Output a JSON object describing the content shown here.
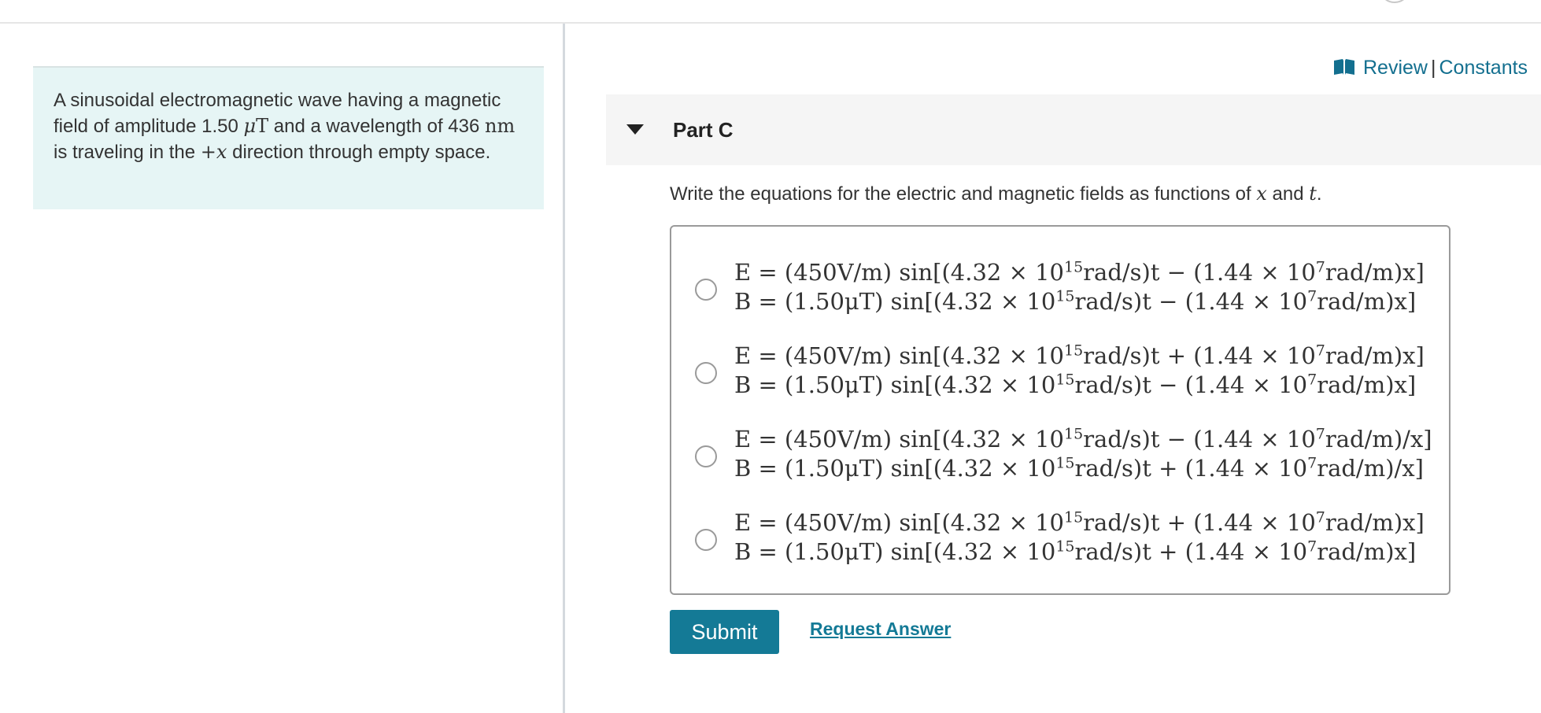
{
  "problem": {
    "seg1": "A sinusoidal electromagnetic wave having a magnetic field of amplitude 1.50 ",
    "mu": "μ",
    "unit_T": "T",
    "seg2": " and a wavelength of 436 ",
    "unit_nm": "nm",
    "seg3": " is traveling in the ",
    "dir": "+x",
    "seg4": " direction through empty space."
  },
  "links": {
    "review": "Review",
    "separator": "|",
    "constants": "Constants"
  },
  "part": {
    "title": "Part C"
  },
  "prompt": {
    "text1": "Write the equations for the electric and magnetic fields as functions of ",
    "var_x": "x",
    "and": " and ",
    "var_t": "t",
    "end": "."
  },
  "choices": [
    {
      "e": {
        "a": "E = (450V/m) sin[(4.32 × 10",
        "exp1": "15",
        "b": "rad/s)t − (1.44 × 10",
        "exp2": "7",
        "c": "rad/m)x]"
      },
      "b": {
        "a": "B = (1.50μT) sin[(4.32 × 10",
        "exp1": "15",
        "b": "rad/s)t − (1.44 × 10",
        "exp2": "7",
        "c": "rad/m)x]"
      }
    },
    {
      "e": {
        "a": "E = (450V/m) sin[(4.32 × 10",
        "exp1": "15",
        "b": "rad/s)t + (1.44 × 10",
        "exp2": "7",
        "c": "rad/m)x]"
      },
      "b": {
        "a": "B = (1.50μT) sin[(4.32 × 10",
        "exp1": "15",
        "b": "rad/s)t − (1.44 × 10",
        "exp2": "7",
        "c": "rad/m)x]"
      }
    },
    {
      "e": {
        "a": "E = (450V/m) sin[(4.32 × 10",
        "exp1": "15",
        "b": "rad/s)t − (1.44 × 10",
        "exp2": "7",
        "c": "rad/m)/x]"
      },
      "b": {
        "a": "B = (1.50μT) sin[(4.32 × 10",
        "exp1": "15",
        "b": "rad/s)t + (1.44 × 10",
        "exp2": "7",
        "c": "rad/m)/x]"
      }
    },
    {
      "e": {
        "a": "E = (450V/m) sin[(4.32 × 10",
        "exp1": "15",
        "b": "rad/s)t + (1.44 × 10",
        "exp2": "7",
        "c": "rad/m)x]"
      },
      "b": {
        "a": "B = (1.50μT) sin[(4.32 × 10",
        "exp1": "15",
        "b": "rad/s)t + (1.44 × 10",
        "exp2": "7",
        "c": "rad/m)x]"
      }
    }
  ],
  "actions": {
    "submit": "Submit",
    "request_answer": "Request Answer"
  },
  "colors": {
    "accent": "#147a96",
    "link": "#136f8f",
    "problem_bg": "#e6f5f5",
    "part_header_bg": "#f5f5f5"
  },
  "icons": {
    "review": "book-icon",
    "collapse": "caret-down-icon",
    "avatar": "avatar"
  }
}
